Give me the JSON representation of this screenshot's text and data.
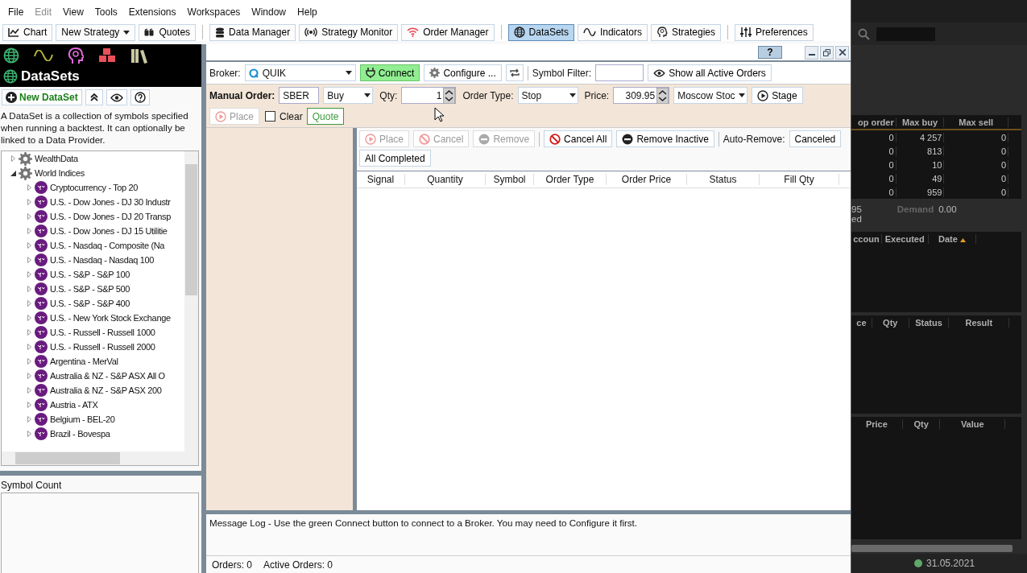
{
  "menu": [
    {
      "label": "File",
      "disabled": false
    },
    {
      "label": "Edit",
      "disabled": true
    },
    {
      "label": "View",
      "disabled": false
    },
    {
      "label": "Tools",
      "disabled": false
    },
    {
      "label": "Extensions",
      "disabled": false
    },
    {
      "label": "Workspaces",
      "disabled": false
    },
    {
      "label": "Window",
      "disabled": false
    },
    {
      "label": "Help",
      "disabled": false
    }
  ],
  "toolbar": [
    [
      {
        "label": "Chart",
        "kind": "button",
        "selected": false
      },
      {
        "label": "New Strategy",
        "kind": "dropdown",
        "selected": false
      },
      {
        "label": "Quotes",
        "kind": "button",
        "selected": false
      }
    ],
    [
      {
        "label": "Data Manager",
        "kind": "button",
        "selected": false
      },
      {
        "label": "Strategy Monitor",
        "kind": "button",
        "selected": false
      },
      {
        "label": "Order Manager",
        "kind": "button",
        "selected": false
      }
    ],
    [
      {
        "label": "DataSets",
        "kind": "button",
        "selected": true
      },
      {
        "label": "Indicators",
        "kind": "button",
        "selected": false
      },
      {
        "label": "Strategies",
        "kind": "button",
        "selected": false
      }
    ],
    [
      {
        "label": "Preferences",
        "kind": "button",
        "selected": false
      }
    ]
  ],
  "sidebar": {
    "title": "DataSets",
    "new_button": "New DataSet",
    "description": "A DataSet is a collection of symbols specified when running a backtest. It can optionally be linked to a Data Provider.",
    "tree": [
      {
        "label": "WealthData",
        "expanded": false
      },
      {
        "label": "World Indices",
        "expanded": true,
        "children": [
          {
            "label": "Cryptocurrency - Top 20",
            "expanded": false
          },
          {
            "label": "U.S. - Dow Jones - DJ 30 Industr",
            "expanded": false
          },
          {
            "label": "U.S. - Dow Jones - DJ 20 Transp",
            "expanded": false
          },
          {
            "label": "U.S. - Dow Jones - DJ 15 Utilitie",
            "expanded": false
          },
          {
            "label": "U.S. - Nasdaq - Composite (Na",
            "expanded": false
          },
          {
            "label": "U.S. - Nasdaq - Nasdaq 100",
            "expanded": false
          },
          {
            "label": "U.S. - S&P - S&P 100",
            "expanded": false
          },
          {
            "label": "U.S. - S&P - S&P 500",
            "expanded": false
          },
          {
            "label": "U.S. - S&P - S&P 400",
            "expanded": false
          },
          {
            "label": "U.S. - New York Stock Exchange",
            "expanded": false
          },
          {
            "label": "U.S. - Russell - Russell 1000",
            "expanded": false
          },
          {
            "label": "U.S. - Russell - Russell 2000",
            "expanded": false
          },
          {
            "label": "Argentina - MerVal",
            "expanded": false
          },
          {
            "label": "Australia & NZ - S&P ASX All O",
            "expanded": false
          },
          {
            "label": "Australia & NZ - S&P ASX 200",
            "expanded": false
          },
          {
            "label": "Austria - ATX",
            "expanded": false
          },
          {
            "label": "Belgium - BEL-20",
            "expanded": false
          },
          {
            "label": "Brazil - Bovespa",
            "expanded": false
          }
        ]
      }
    ],
    "symbol_count_label": "Symbol Count"
  },
  "order_manager": {
    "help_button": "?",
    "broker": {
      "label": "Broker:",
      "value": "QUIK"
    },
    "connect_button": "Connect",
    "configure_button": "Configure ...",
    "symbol_filter_label": "Symbol Filter:",
    "show_active_button": "Show all Active Orders",
    "manual_order": {
      "label": "Manual Order:",
      "symbol": "SBER",
      "side": "Buy",
      "qty_label": "Qty:",
      "qty": "1",
      "order_type_label": "Order Type:",
      "order_type": "Stop",
      "price_label": "Price:",
      "price": "309.95",
      "exchange": "Moscow Stoc",
      "stage_button": "Stage",
      "place": {
        "label": "Place",
        "disabled": true
      },
      "clear": {
        "label": "Clear",
        "checked": false
      },
      "quote_button": "Quote"
    },
    "orders_toolbar": [
      {
        "label": "Place",
        "disabled": true
      },
      {
        "label": "Cancel",
        "disabled": true
      },
      {
        "label": "Remove",
        "disabled": true
      },
      {
        "label": "Cancel All",
        "disabled": false
      },
      {
        "label": "Remove Inactive",
        "disabled": false
      }
    ],
    "auto_remove": {
      "label": "Auto-Remove:",
      "buttons": [
        "Canceled",
        "All Completed"
      ]
    },
    "columns": [
      "Signal",
      "Quantity",
      "Symbol",
      "Order Type",
      "Order Price",
      "Status",
      "Fill Qty"
    ],
    "message_log": "Message Log - Use the green Connect button to connect to a Broker. You may need to Configure it first.",
    "status": [
      "Orders: 0",
      "Active Orders: 0"
    ]
  },
  "dark_panel": {
    "limits_table": {
      "columns": [
        "op order",
        "Max buy",
        "Max sell"
      ],
      "rows": [
        [
          "0",
          "4 257",
          "0"
        ],
        [
          "0",
          "813",
          "0"
        ],
        [
          "0",
          "10",
          "0"
        ],
        [
          "0",
          "49",
          "0"
        ],
        [
          "0",
          "959",
          "0"
        ]
      ]
    },
    "summary": {
      "value": "95",
      "demand_label": "Demand",
      "demand": "0.00",
      "note": "ed"
    },
    "tables": [
      {
        "columns": [
          "ccoun",
          "Executed",
          "Date"
        ]
      },
      {
        "columns": [
          "ce",
          "Qty",
          "Status",
          "Result"
        ]
      },
      {
        "columns": [
          "Price",
          "Qty",
          "Value"
        ]
      }
    ],
    "date": "31.05.2021"
  }
}
